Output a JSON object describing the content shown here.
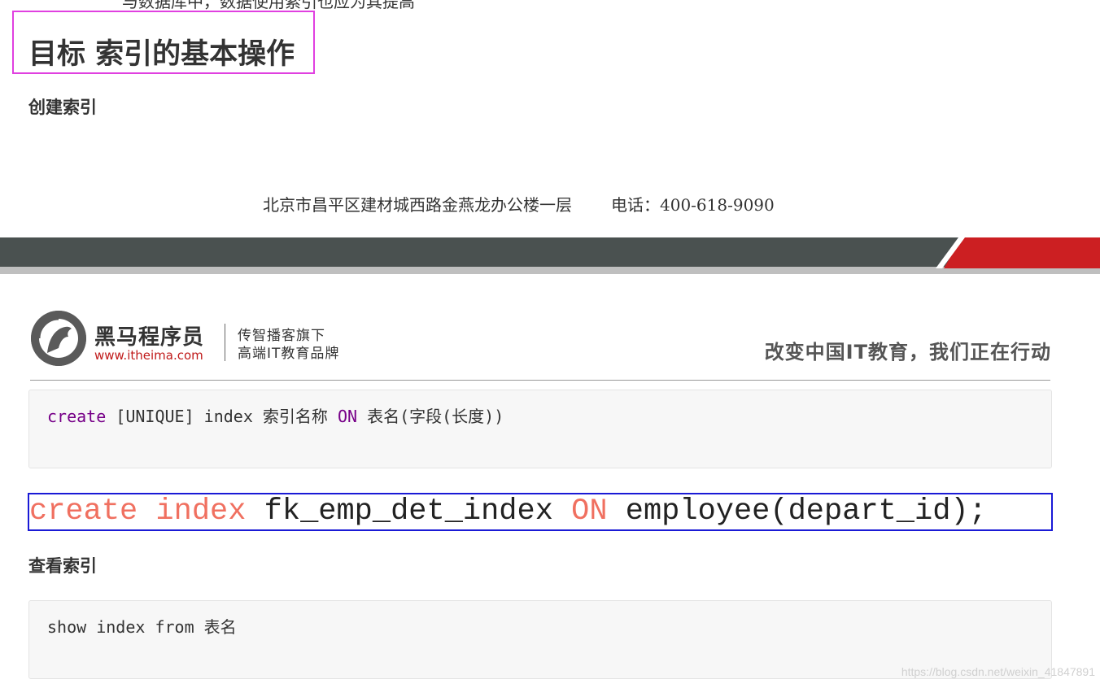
{
  "top_cut_text": "与数据库中，数据使用索引也应为其提高",
  "section_title": "目标 索引的基本操作",
  "heading_create": "创建索引",
  "footer": {
    "address": "北京市昌平区建材城西路金燕龙办公楼一层",
    "phone": "电话：400-618-9090"
  },
  "brand": {
    "name": "黑马程序员",
    "url": "www.itheima.com",
    "sub1": "传智播客旗下",
    "sub2": "高端IT教育品牌",
    "slogan": "改变中国IT教育，我们正在行动"
  },
  "code_create": {
    "kw_create": "create",
    "part1": " [UNIQUE] index 索引名称 ",
    "kw_on": "ON",
    "part2": " 表名(字段(长度))"
  },
  "example_code": {
    "kw1": "create index",
    "mid": " fk_emp_det_index ",
    "kw2": "ON",
    "tail": " employee(depart_id);"
  },
  "heading_show": "查看索引",
  "code_show": "show index from 表名",
  "watermark": "https://blog.csdn.net/weixin_41847891",
  "colors": {
    "title_box_border": "#e040e0",
    "example_box_border": "#1a1ad6",
    "keyword": "#770088",
    "keyword_red": "#f07060",
    "band_dark": "#4a5150",
    "band_red": "#cc1f22"
  },
  "icons": [
    "horse-logo-icon"
  ]
}
